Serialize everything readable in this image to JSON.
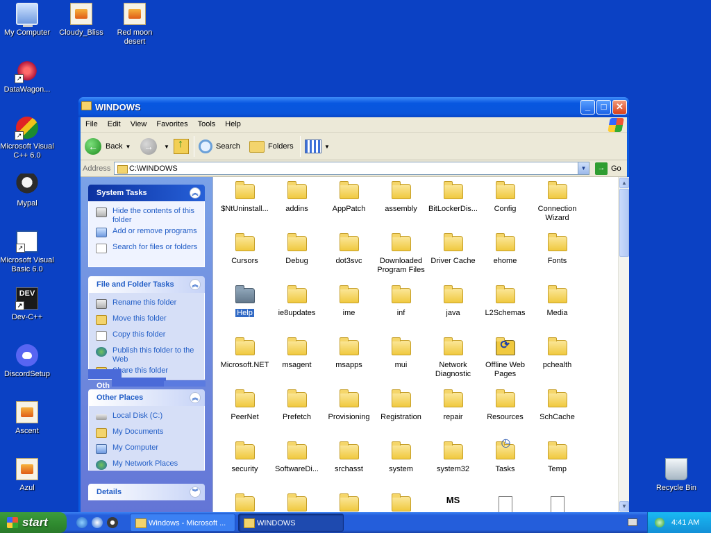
{
  "desktop": {
    "icons": [
      {
        "label": "My Computer"
      },
      {
        "label": "Cloudy_Bliss"
      },
      {
        "label": "Red moon desert"
      },
      {
        "label": "DataWagon..."
      },
      {
        "label": "Microsoft Visual C++ 6.0"
      },
      {
        "label": "Mypal"
      },
      {
        "label": "Microsoft Visual Basic 6.0"
      },
      {
        "label": "Dev-C++"
      },
      {
        "label": "DiscordSetup"
      },
      {
        "label": "Ascent"
      },
      {
        "label": "Azul"
      },
      {
        "label": "Recycle Bin"
      }
    ],
    "dev_badge": "DEV"
  },
  "window": {
    "title": "WINDOWS",
    "menu": [
      "File",
      "Edit",
      "View",
      "Favorites",
      "Tools",
      "Help"
    ],
    "toolbar": {
      "back": "Back",
      "search": "Search",
      "folders": "Folders"
    },
    "address": {
      "label": "Address",
      "value": "C:\\WINDOWS",
      "go": "Go"
    }
  },
  "tasks": {
    "system": {
      "title": "System Tasks",
      "items": [
        "Hide the contents of this folder",
        "Add or remove programs",
        "Search for files or folders"
      ]
    },
    "file_folder": {
      "title": "File and Folder Tasks",
      "items": [
        "Rename this folder",
        "Move this folder",
        "Copy this folder",
        "Publish this folder to the Web",
        "Share this folder"
      ]
    },
    "other_places": {
      "title": "Other Places",
      "ghost_title": "Oth",
      "items": [
        "Local Disk (C:)",
        "My Documents",
        "My Computer",
        "My Network Places"
      ]
    },
    "details": {
      "title": "Details"
    }
  },
  "files": [
    "$NtUninstall...",
    "addins",
    "AppPatch",
    "assembly",
    "BitLockerDis...",
    "Config",
    "Connection Wizard",
    "Cursors",
    "Debug",
    "dot3svc",
    "Downloaded Program Files",
    "Driver Cache",
    "ehome",
    "Fonts",
    "Help",
    "ie8updates",
    "ime",
    "inf",
    "java",
    "L2Schemas",
    "Media",
    "Microsoft.NET",
    "msagent",
    "msapps",
    "mui",
    "Network Diagnostic",
    "Offline Web Pages",
    "pchealth",
    "PeerNet",
    "Prefetch",
    "Provisioning",
    "Registration",
    "repair",
    "Resources",
    "SchCache",
    "security",
    "SoftwareDi...",
    "srchasst",
    "system",
    "system32",
    "Tasks",
    "Temp"
  ],
  "selected_file": "Help",
  "bottom_row_glyph": "MS",
  "taskbar": {
    "start": "start",
    "tasks": [
      "Windows - Microsoft ...",
      "WINDOWS"
    ],
    "clock": "4:41 AM"
  },
  "colors": {
    "desktop": "#0b41c4",
    "selection": "#316ac5",
    "task_link": "#215dc6"
  }
}
